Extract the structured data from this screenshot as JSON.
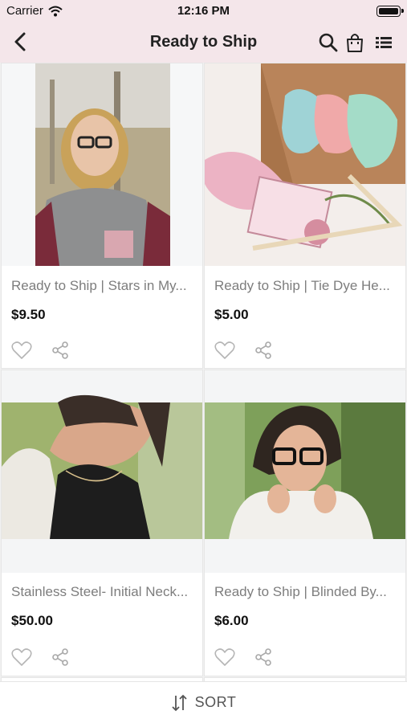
{
  "status": {
    "carrier": "Carrier",
    "time": "12:16 PM"
  },
  "nav": {
    "title": "Ready to Ship"
  },
  "products": [
    {
      "name": "Ready to Ship | Stars in My...",
      "price": "$9.50"
    },
    {
      "name": "Ready to Ship | Tie Dye He...",
      "price": "$5.00"
    },
    {
      "name": "Stainless Steel- Initial Neck...",
      "price": "$50.00"
    },
    {
      "name": "Ready to Ship | Blinded By...",
      "price": "$6.00"
    }
  ],
  "sort": {
    "label": "SORT"
  },
  "colors": {
    "header_bg": "#f4e6ea",
    "name_text": "#7d7d7d",
    "price_text": "#111111"
  },
  "icons": [
    "back-icon",
    "search-icon",
    "bag-icon",
    "list-icon",
    "heart-icon",
    "share-icon",
    "sort-icon"
  ]
}
